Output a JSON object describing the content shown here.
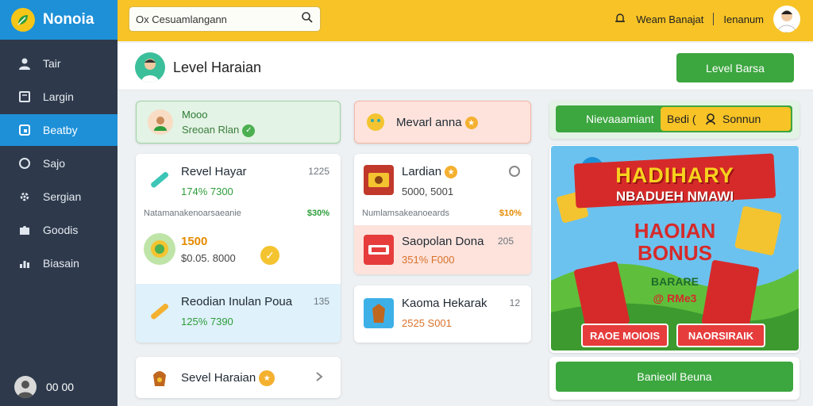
{
  "brand": {
    "name": "Nonoia",
    "logo_icon": "leaf-icon"
  },
  "sidebar": {
    "items": [
      {
        "label": "Tair",
        "icon": "person-icon"
      },
      {
        "label": "Largin",
        "icon": "note-icon"
      },
      {
        "label": "Beatby",
        "icon": "tag-icon",
        "active": true
      },
      {
        "label": "Sajo",
        "icon": "circle-icon"
      },
      {
        "label": "Sergian",
        "icon": "gear-icon"
      },
      {
        "label": "Goodis",
        "icon": "puzzle-icon"
      },
      {
        "label": "Biasain",
        "icon": "chart-icon"
      }
    ],
    "footer_text": "00 00"
  },
  "topbar": {
    "search_value": "Ox Cesuamlangann",
    "user_name": "Weam Banajat",
    "user_secondary": "Ienanum"
  },
  "page_header": {
    "title": "Level Haraian",
    "button_label": "Level Barsa"
  },
  "left_column": {
    "top_card": {
      "title": "Mooo",
      "subtitle": "Sreoan Rlan"
    },
    "list_card": {
      "rows": [
        {
          "title": "Revel Hayar",
          "sub": "174% 7300",
          "number": "1225"
        },
        {
          "note": "Natamanakenoarsaeanie",
          "pct": "$30%"
        },
        {
          "title": "1500",
          "sub": "$0.05. 8000"
        },
        {
          "title": "Reodian Inulan Poua",
          "sub": "125% 7390",
          "number": "135"
        }
      ]
    },
    "bottom_card": {
      "title": "Sevel Haraian"
    }
  },
  "middle_column": {
    "top_card": {
      "title": "Mevarl anna"
    },
    "list_card": {
      "rows": [
        {
          "title": "Lardian",
          "sub": "5000, 5001"
        },
        {
          "note": "Numlamsakeanoeards",
          "pct": "$10%"
        },
        {
          "title": "Saopolan Dona",
          "sub": "351% F000",
          "number": "205"
        }
      ]
    },
    "card3": {
      "title": "Kaoma Hekarak",
      "sub": "2525 S001",
      "number": "12"
    }
  },
  "right_column": {
    "pill_label": "Nievaaamiant",
    "pill_highlight": "Bedi (",
    "pill_right": "Sonnun",
    "promo": {
      "line1": "HADIHARY",
      "line2": "NBADUEH NMAWI",
      "line3": "HAOIAN",
      "line4": "BONUS",
      "line5": "BARARE",
      "line6": "@ RMe3",
      "button_left": "RAOE MOIOIS",
      "button_right": "NAORSIRAIK"
    },
    "bottom_button": "Banieoll Beuna"
  },
  "colors": {
    "topbar": "#f7c326",
    "sidebar": "#2e3a4c",
    "accent_blue": "#1e90d8",
    "green": "#3ca63f"
  }
}
